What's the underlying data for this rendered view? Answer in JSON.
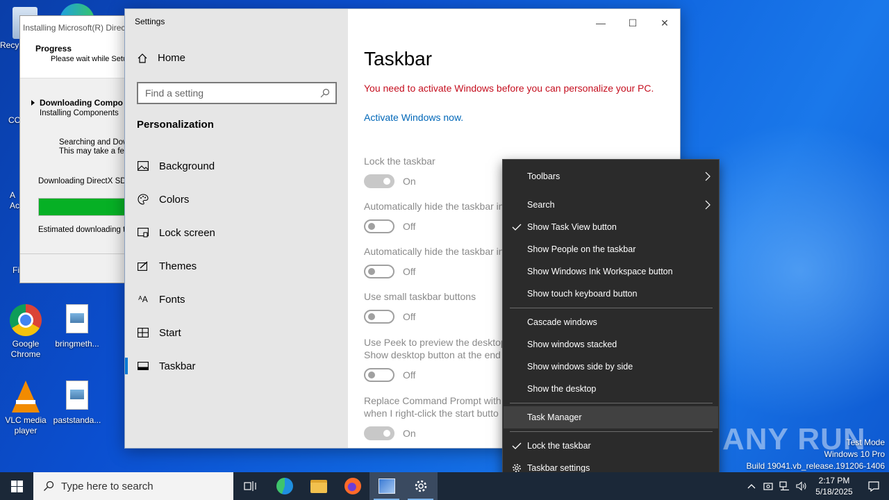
{
  "desktop": {
    "icons": [
      {
        "label": "Recy"
      },
      {
        "label": "CC"
      },
      {
        "label": "A Ac"
      },
      {
        "label": "Fi"
      },
      {
        "label": "Google Chrome"
      },
      {
        "label": "bringmeth..."
      },
      {
        "label": "VLC media player"
      },
      {
        "label": "paststanda..."
      }
    ]
  },
  "installer": {
    "title": "Installing Microsoft(R) Direc",
    "header_title": "Progress",
    "header_subtitle": "Please wait while Setu",
    "step_title": "Downloading Compo",
    "step_subtitle": "Installing Components",
    "search_line1": "Searching and Dow",
    "search_line2": "This may take a few",
    "download_label": "Downloading DirectX SDK",
    "progress": 0.85,
    "estimate_label": "Estimated downloading tim"
  },
  "settings": {
    "window_title": "Settings",
    "home_label": "Home",
    "search_placeholder": "Find a setting",
    "section_label": "Personalization",
    "nav": [
      {
        "label": "Background",
        "icon": "image-icon"
      },
      {
        "label": "Colors",
        "icon": "palette-icon"
      },
      {
        "label": "Lock screen",
        "icon": "lock-screen-icon"
      },
      {
        "label": "Themes",
        "icon": "themes-icon"
      },
      {
        "label": "Fonts",
        "icon": "fonts-icon"
      },
      {
        "label": "Start",
        "icon": "start-icon"
      },
      {
        "label": "Taskbar",
        "icon": "taskbar-icon",
        "active": true
      }
    ],
    "page_title": "Taskbar",
    "warning": "You need to activate Windows before you can personalize your PC.",
    "activate_link": "Activate Windows now.",
    "options": [
      {
        "label": "Lock the taskbar",
        "state": "On"
      },
      {
        "label": "Automatically hide the taskbar in",
        "state": "Off"
      },
      {
        "label": "Automatically hide the taskbar in",
        "state": "Off"
      },
      {
        "label": "Use small taskbar buttons",
        "state": "Off"
      },
      {
        "label": "Use Peek to preview the desktop",
        "label2": "Show desktop button at the end",
        "state": "Off"
      },
      {
        "label": "Replace Command Prompt with",
        "label2": "when I right-click the start butto",
        "state": "On"
      }
    ],
    "minimize_glyph": "—",
    "maximize_glyph": "☐",
    "close_glyph": "✕"
  },
  "context_menu": {
    "items": [
      {
        "label": "Toolbars",
        "submenu": true
      },
      {
        "label": "Search",
        "submenu": true
      },
      {
        "label": "Show Task View button",
        "checked": true
      },
      {
        "label": "Show People on the taskbar"
      },
      {
        "label": "Show Windows Ink Workspace button"
      },
      {
        "label": "Show touch keyboard button"
      },
      {
        "label": "Cascade windows"
      },
      {
        "label": "Show windows stacked"
      },
      {
        "label": "Show windows side by side"
      },
      {
        "label": "Show the desktop"
      },
      {
        "label": "Task Manager",
        "highlighted": true
      },
      {
        "label": "Lock the taskbar",
        "checked": true
      },
      {
        "label": "Taskbar settings",
        "icon": "gear-icon"
      }
    ]
  },
  "watermark": {
    "logo": "ANY RUN",
    "line1": "Test Mode",
    "line2": "Windows 10 Pro",
    "line3": "Build 19041.vb_release.191206-1406"
  },
  "taskbar": {
    "search_placeholder": "Type here to search",
    "time": "2:17 PM",
    "date": "5/18/2025",
    "apps": [
      "task-view-icon",
      "edge-icon",
      "file-explorer-icon",
      "firefox-icon",
      "directx-setup-icon",
      "settings-gear-icon"
    ]
  },
  "colors": {
    "accent": "#0078d4",
    "warning": "#c50f1f",
    "link": "#0067b8",
    "menu_bg": "#2b2b2b",
    "taskbar_bg": "#1b2838"
  }
}
